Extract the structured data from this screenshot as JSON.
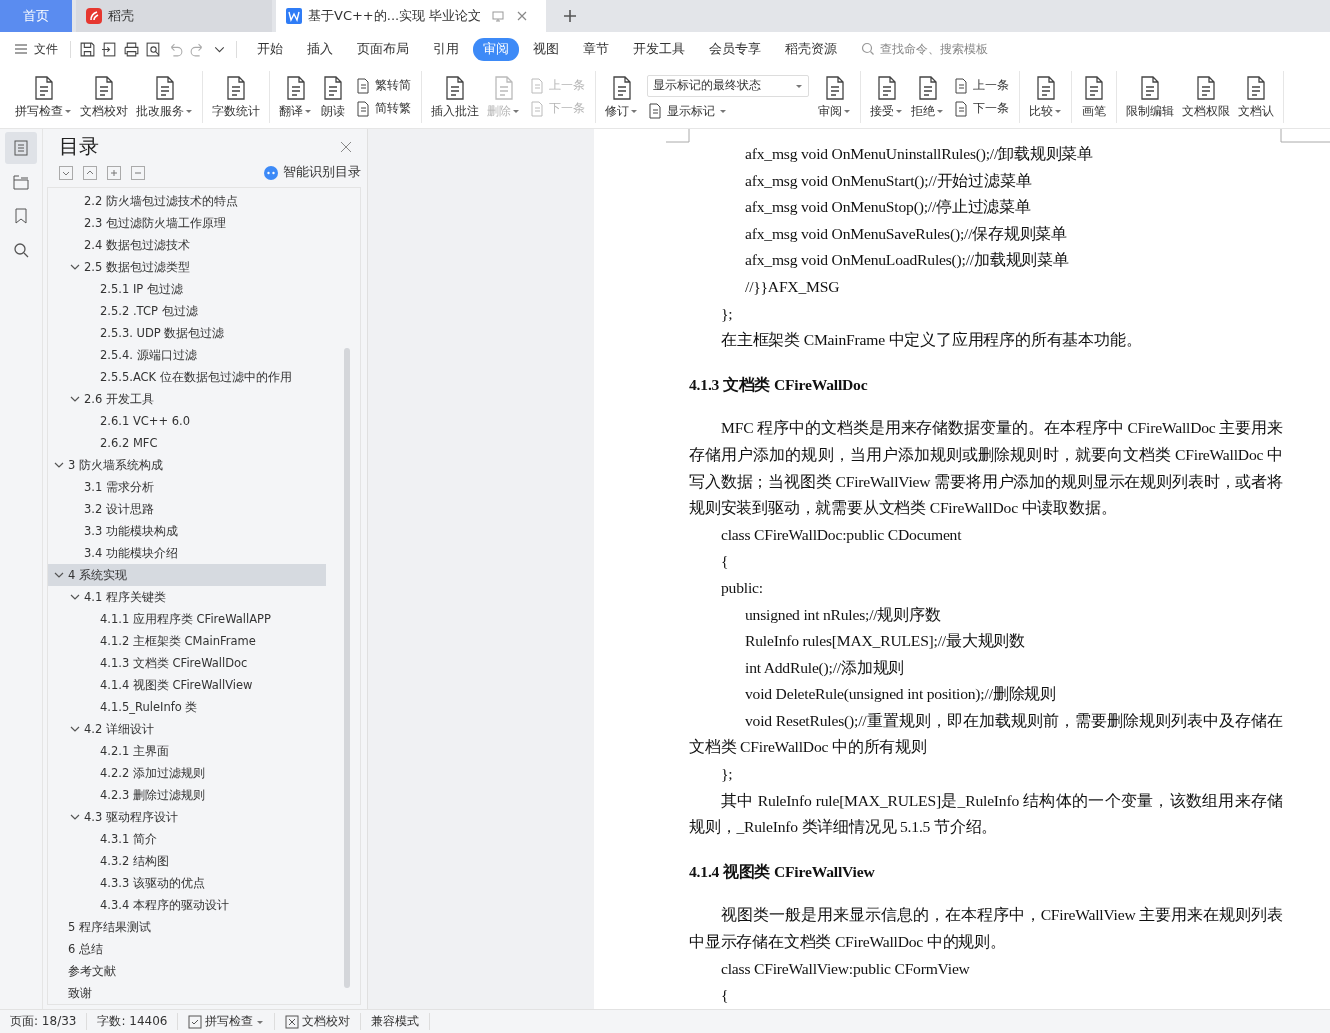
{
  "tabs": [
    {
      "kind": "home",
      "label": "首页",
      "selected": false
    },
    {
      "kind": "app",
      "label": "稻壳",
      "selected": false
    },
    {
      "kind": "doc",
      "label": "基于VC++的...实现 毕业论文",
      "selected": true
    }
  ],
  "menu": {
    "file": "文件",
    "items": [
      {
        "label": "开始",
        "selected": false
      },
      {
        "label": "插入",
        "selected": false
      },
      {
        "label": "页面布局",
        "selected": false
      },
      {
        "label": "引用",
        "selected": false
      },
      {
        "label": "审阅",
        "selected": true
      },
      {
        "label": "视图",
        "selected": false
      },
      {
        "label": "章节",
        "selected": false
      },
      {
        "label": "开发工具",
        "selected": false
      },
      {
        "label": "会员专享",
        "selected": false
      },
      {
        "label": "稻壳资源",
        "selected": false
      }
    ],
    "search_placeholder": "查找命令、搜索模板"
  },
  "ribbon": [
    [
      {
        "kind": "big",
        "label": "拼写检查",
        "dropdown": true,
        "disabled": false
      },
      {
        "kind": "big",
        "label": "文档校对",
        "dropdown": false,
        "disabled": false
      },
      {
        "kind": "big",
        "label": "批改服务",
        "dropdown": true,
        "disabled": false
      }
    ],
    [
      {
        "kind": "big",
        "label": "字数统计",
        "dropdown": false,
        "disabled": false
      }
    ],
    [
      {
        "kind": "big",
        "label": "翻译",
        "dropdown": true,
        "disabled": false
      },
      {
        "kind": "big",
        "label": "朗读",
        "dropdown": false,
        "disabled": false
      },
      {
        "kind": "pair",
        "items": [
          {
            "label": "繁转简",
            "disabled": false
          },
          {
            "label": "简转繁",
            "disabled": false
          }
        ]
      }
    ],
    [
      {
        "kind": "big",
        "label": "插入批注",
        "dropdown": false,
        "disabled": false
      },
      {
        "kind": "big",
        "label": "删除",
        "dropdown": true,
        "disabled": true
      },
      {
        "kind": "pair",
        "items": [
          {
            "label": "上一条",
            "disabled": true
          },
          {
            "label": "下一条",
            "disabled": true
          }
        ]
      }
    ],
    [
      {
        "kind": "big",
        "label": "修订",
        "dropdown": true,
        "disabled": false
      },
      {
        "kind": "select",
        "value": "显示标记的最终状态",
        "sublabel": "显示标记"
      },
      {
        "kind": "big",
        "label": "审阅",
        "dropdown": true,
        "disabled": false
      }
    ],
    [
      {
        "kind": "big",
        "label": "接受",
        "dropdown": true,
        "disabled": false
      },
      {
        "kind": "big",
        "label": "拒绝",
        "dropdown": true,
        "disabled": false
      },
      {
        "kind": "pair",
        "items": [
          {
            "label": "上一条",
            "disabled": false
          },
          {
            "label": "下一条",
            "disabled": false
          }
        ]
      }
    ],
    [
      {
        "kind": "big",
        "label": "比较",
        "dropdown": true,
        "disabled": false
      }
    ],
    [
      {
        "kind": "big",
        "label": "画笔",
        "dropdown": false,
        "disabled": false
      }
    ],
    [
      {
        "kind": "big",
        "label": "限制编辑",
        "dropdown": false,
        "disabled": false
      },
      {
        "kind": "big",
        "label": "文档权限",
        "dropdown": false,
        "disabled": false
      },
      {
        "kind": "big",
        "label": "文档认",
        "dropdown": false,
        "disabled": false
      }
    ]
  ],
  "rail": [
    {
      "selected": true
    },
    {
      "selected": false
    },
    {
      "selected": false
    },
    {
      "selected": false
    }
  ],
  "toc": {
    "title": "目录",
    "smart_button": "智能识别目录",
    "continued": [
      {
        "label": "2.2  防火墙包过滤技术的特点",
        "selected": false
      },
      {
        "label": "2.3  包过滤防火墙工作原理",
        "selected": false
      },
      {
        "label": "2.4  数据包过滤技术",
        "selected": false
      },
      {
        "label": "2.5  数据包过滤类型",
        "selected": false,
        "expanded": true,
        "children": [
          {
            "label": "2.5.1 IP 包过滤",
            "selected": false
          },
          {
            "label": "2.5.2 .TCP 包过滤",
            "selected": false
          },
          {
            "label": "2.5.3. UDP 数据包过滤",
            "selected": false
          },
          {
            "label": "2.5.4.  源端口过滤",
            "selected": false
          },
          {
            "label": "2.5.5.ACK 位在数据包过滤中的作用",
            "selected": false
          }
        ]
      },
      {
        "label": "2.6 开发工具",
        "selected": false,
        "expanded": true,
        "children": [
          {
            "label": "2.6.1 VC++ 6.0",
            "selected": false
          },
          {
            "label": "2.6.2 MFC",
            "selected": false
          }
        ]
      }
    ],
    "items": [
      {
        "label": "3  防火墙系统构成",
        "selected": false,
        "expanded": true,
        "children": [
          {
            "label": "3.1  需求分析",
            "selected": false
          },
          {
            "label": "3.2  设计思路",
            "selected": false
          },
          {
            "label": "3.3  功能模块构成",
            "selected": false
          },
          {
            "label": "3.4  功能模块介绍",
            "selected": false
          }
        ]
      },
      {
        "label": "4  系统实现",
        "selected": true,
        "expanded": true,
        "children": [
          {
            "label": "4.1 程序关键类",
            "selected": false,
            "expanded": true,
            "children": [
              {
                "label": "4.1.1 应用程序类 CFireWallAPP",
                "selected": false
              },
              {
                "label": "4.1.2 主框架类 CMainFrame",
                "selected": false
              },
              {
                "label": "4.1.3 文档类 CFireWallDoc",
                "selected": false
              },
              {
                "label": "4.1.4 视图类 CFireWallView",
                "selected": false
              },
              {
                "label": "4.1.5_RuleInfo 类",
                "selected": false
              }
            ]
          },
          {
            "label": "4.2 详细设计",
            "selected": false,
            "expanded": true,
            "children": [
              {
                "label": "4.2.1 主界面",
                "selected": false
              },
              {
                "label": "4.2.2 添加过滤规则",
                "selected": false
              },
              {
                "label": "4.2.3 删除过滤规则",
                "selected": false
              }
            ]
          },
          {
            "label": "4.3 驱动程序设计",
            "selected": false,
            "expanded": true,
            "children": [
              {
                "label": "4.3.1 简介",
                "selected": false
              },
              {
                "label": "4.3.2 结构图",
                "selected": false
              },
              {
                "label": "4.3.3 该驱动的优点",
                "selected": false
              },
              {
                "label": "4.3.4 本程序的驱动设计",
                "selected": false
              }
            ]
          }
        ]
      },
      {
        "label": "5  程序结果测试",
        "selected": false
      },
      {
        "label": "6  总结",
        "selected": false
      },
      {
        "label": "参考文献",
        "selected": false
      },
      {
        "label": "致谢",
        "selected": false
      }
    ]
  },
  "document": [
    {
      "kind": "code2",
      "text": "afx_msg void OnMenuUninstallRules();//卸载规则菜单"
    },
    {
      "kind": "code2",
      "text": "afx_msg void OnMenuStart();//开始过滤菜单"
    },
    {
      "kind": "code2",
      "text": "afx_msg void OnMenuStop();//停止过滤菜单"
    },
    {
      "kind": "code2",
      "text": "afx_msg void OnMenuSaveRules();//保存规则菜单"
    },
    {
      "kind": "code2",
      "text": "afx_msg void OnMenuLoadRules();//加载规则菜单"
    },
    {
      "kind": "code2",
      "text": "//}}AFX_MSG"
    },
    {
      "kind": "code1",
      "text": "};"
    },
    {
      "kind": "para",
      "text": "在主框架类 CMainFrame 中定义了应用程序的所有基本功能。"
    },
    {
      "kind": "heading",
      "text": "4.1.3 文档类 CFireWallDoc"
    },
    {
      "kind": "para",
      "text": "MFC 程序中的文档类是用来存储数据变量的。在本程序中 CFireWallDoc 主要用来存储用户添加的规则，当用户添加规则或删除规则时，就要向文档类 CFireWallDoc 中写入数据；当视图类 CFireWallView 需要将用户添加的规则显示在规则列表时，或者将规则安装到驱动，就需要从文档类 CFireWallDoc 中读取数据。"
    },
    {
      "kind": "code1",
      "text": "class CFireWallDoc:public CDocument"
    },
    {
      "kind": "code1",
      "text": "{"
    },
    {
      "kind": "code1",
      "text": "public:"
    },
    {
      "kind": "code2",
      "text": "unsigned int nRules;//规则序数"
    },
    {
      "kind": "code2",
      "text": "RuleInfo rules[MAX_RULES];//最大规则数"
    },
    {
      "kind": "code2",
      "text": "int AddRule();//添加规则"
    },
    {
      "kind": "code2",
      "text": "void DeleteRule(unsigned int position);//删除规则"
    },
    {
      "kind": "wrap2",
      "text": "void ResetRules();//重置规则，即在加载规则前，需要删除规则列表中及存储在文档类 CFireWallDoc 中的所有规则"
    },
    {
      "kind": "code1",
      "text": "};"
    },
    {
      "kind": "para",
      "text": "其中 RuleInfo rule[MAX_RULES]是_RuleInfo 结构体的一个变量，该数组用来存储规则，_RuleInfo 类详细情况见 5.1.5 节介绍。"
    },
    {
      "kind": "heading",
      "text": "4.1.4 视图类 CFireWallView"
    },
    {
      "kind": "para",
      "text": "视图类一般是用来显示信息的，在本程序中，CFireWallView 主要用来在规则列表中显示存储在文档类 CFireWallDoc 中的规则。"
    },
    {
      "kind": "code1",
      "text": "class CFireWallView:public CFormView"
    },
    {
      "kind": "code1",
      "text": "{"
    }
  ],
  "status": {
    "page": "页面: 18/33",
    "words": "字数: 14406",
    "spell": "拼写检查",
    "proof": "文档校对",
    "mode": "兼容模式"
  }
}
